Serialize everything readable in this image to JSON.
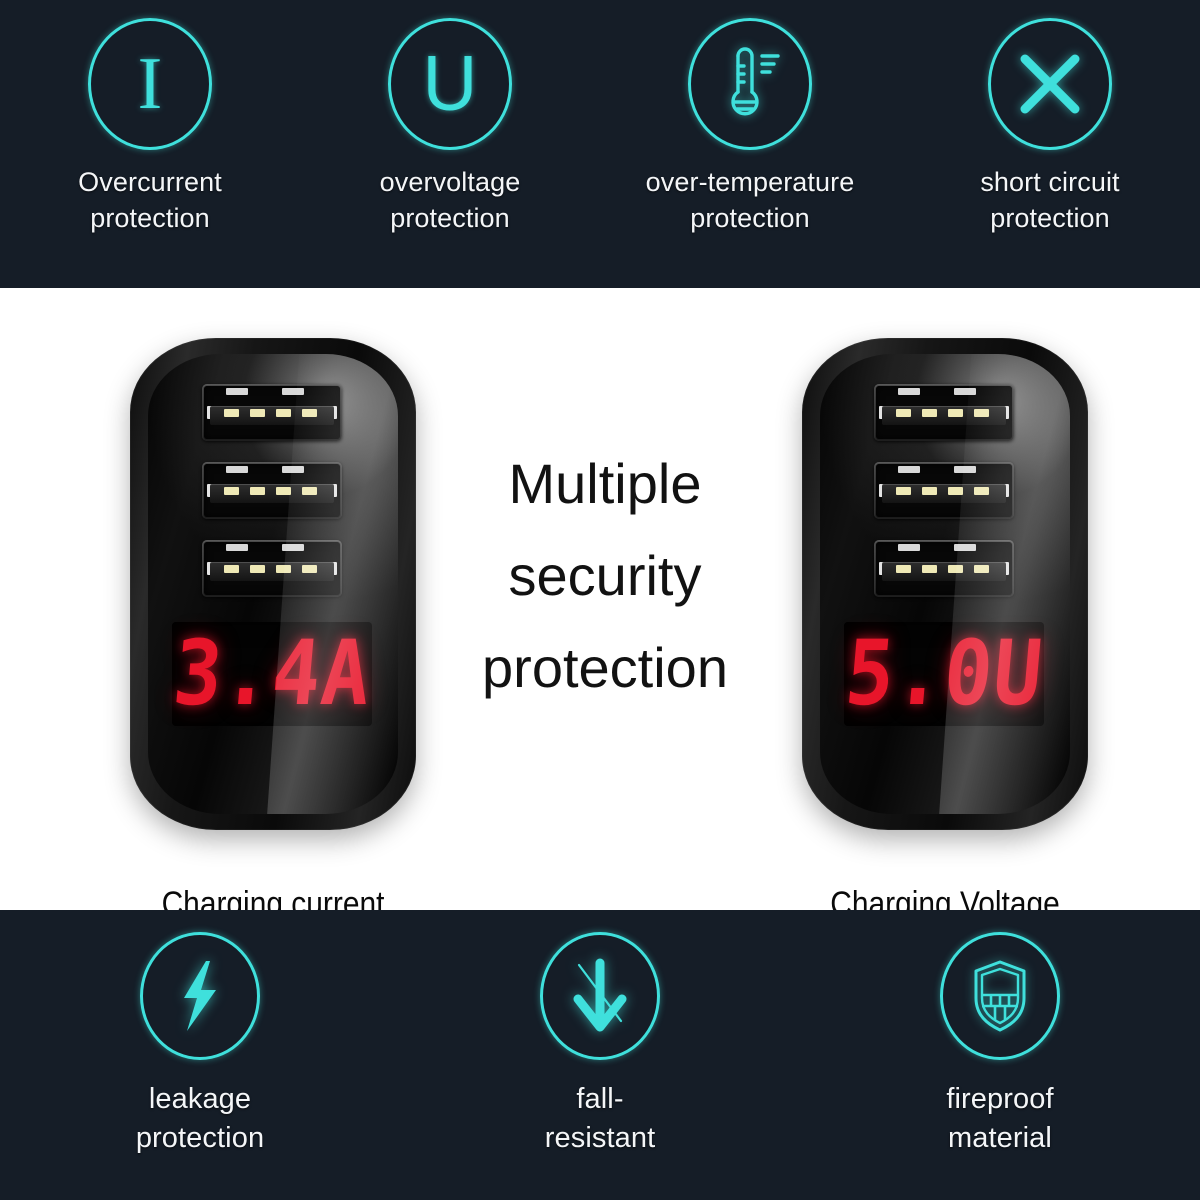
{
  "colors": {
    "banner_bg": "#151d27",
    "accent_cyan": "#3fe0dc",
    "led_red": "#e8152a",
    "stage_bg": "#ffffff",
    "label_text": "#f4f6f8"
  },
  "top_banner": {
    "features": [
      {
        "icon": "current-i-icon",
        "glyph": "I",
        "line1": "Overcurrent",
        "line2": "protection"
      },
      {
        "icon": "voltage-u-icon",
        "glyph": "U",
        "line1": "overvoltage",
        "line2": "protection"
      },
      {
        "icon": "thermometer-icon",
        "glyph": "",
        "line1": "over-temperature",
        "line2": "protection"
      },
      {
        "icon": "cross-x-icon",
        "glyph": "",
        "line1": "short circuit",
        "line2": "protection"
      }
    ]
  },
  "stage": {
    "headline": {
      "line1": "Multiple",
      "line2": "security",
      "line3": "protection"
    },
    "chargers": [
      {
        "name": "charging-current",
        "display": "3.4A",
        "caption": "Charging current",
        "ports": 3
      },
      {
        "name": "charging-voltage",
        "display": "5.0U",
        "caption": "Charging Voltage",
        "ports": 3
      }
    ]
  },
  "bottom_banner": {
    "features": [
      {
        "icon": "lightning-bolt-icon",
        "line1": "leakage",
        "line2": "protection"
      },
      {
        "icon": "down-arrow-strike-icon",
        "line1": "fall-",
        "line2": "resistant"
      },
      {
        "icon": "brick-shield-icon",
        "line1": "fireproof",
        "line2": "material"
      }
    ]
  }
}
